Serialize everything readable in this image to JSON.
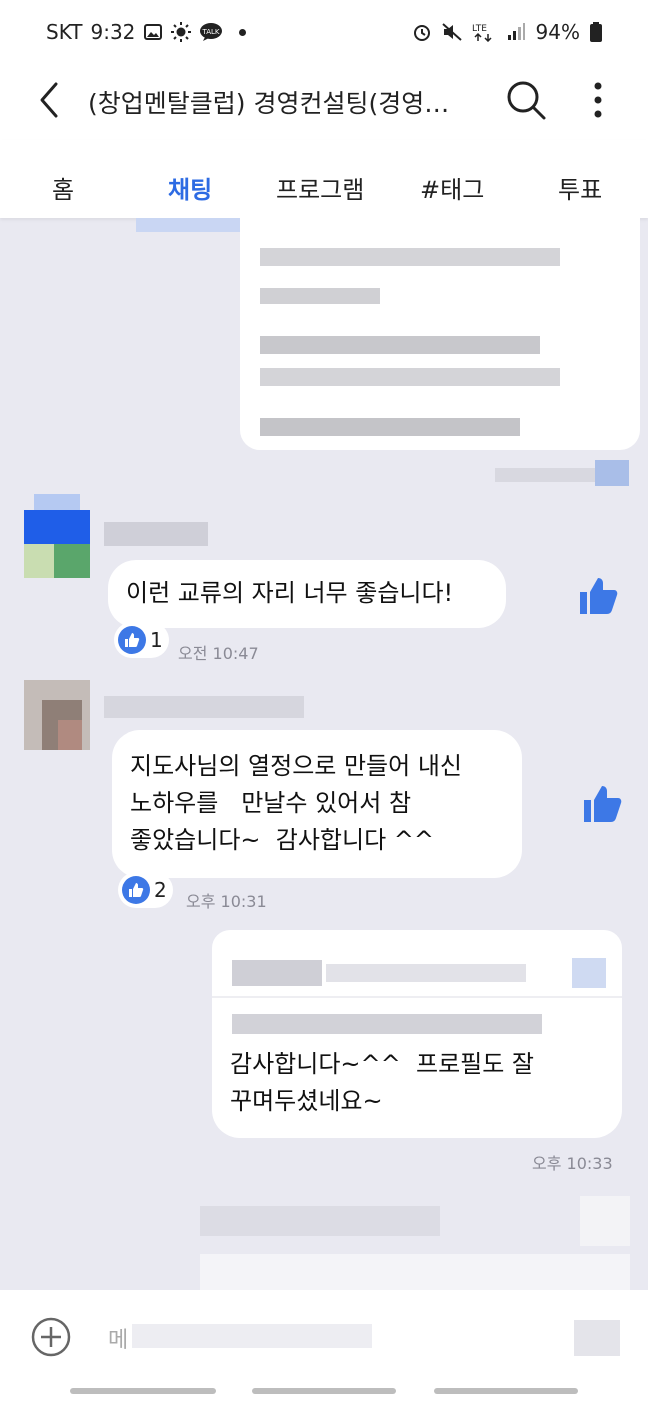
{
  "status": {
    "carrier": "SKT",
    "time": "9:32",
    "battery": "94%",
    "icons_left": [
      "gallery-icon",
      "brightness-icon",
      "talk-icon",
      "dot-icon"
    ],
    "icons_right": [
      "alarm-icon",
      "mute-icon",
      "lte-icon",
      "signal-icon",
      "battery-icon"
    ]
  },
  "header": {
    "title": "(창업멘탈클럽) 경영컨설팅(경영…"
  },
  "tabs": [
    {
      "label": "홈"
    },
    {
      "label": "채팅",
      "active": true
    },
    {
      "label": "프로그램"
    },
    {
      "label": "#태그"
    },
    {
      "label": "투표"
    }
  ],
  "messages": [
    {
      "text": "이런 교류의 자리 너무 좋습니다!",
      "likes": "1",
      "time": "오전 10:47"
    },
    {
      "text": "지도사님의 열정으로 만들어 내신\n노하우를   만날수 있어서 참\n좋았습니다~  감사합니다 ^^",
      "likes": "2",
      "time": "오후 10:31"
    },
    {
      "text": "감사합니다~^^  프로필도 잘\n꾸며두셨네요~",
      "time": "오후 10:33"
    }
  ],
  "composer": {
    "placeholder": "메"
  },
  "colors": {
    "accent": "#2d6be3",
    "background": "#e9e9f1",
    "like": "#3d78e6"
  }
}
